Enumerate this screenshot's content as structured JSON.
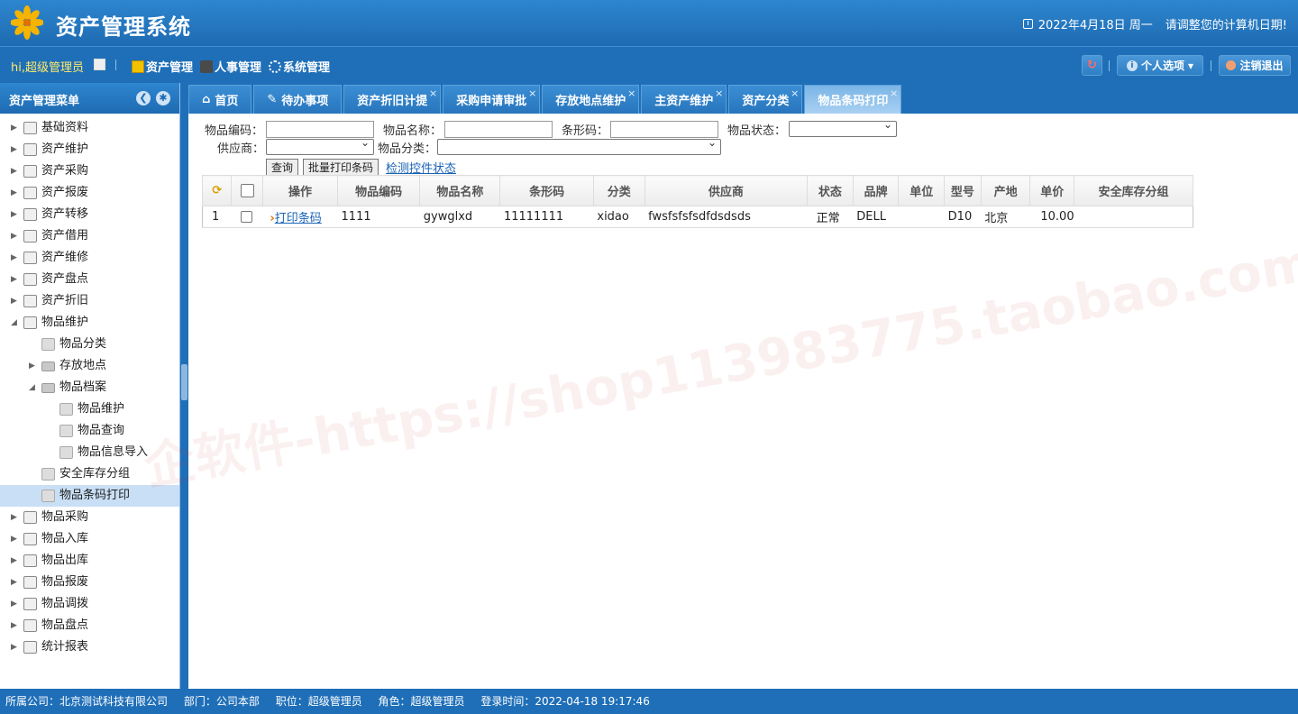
{
  "header": {
    "title": "资产管理系统",
    "date": "2022年4月18日 周一",
    "date_notice": "请调整您的计算机日期!"
  },
  "navbar": {
    "greeting": "hi,超级管理员",
    "menus": [
      "资产管理",
      "人事管理",
      "系统管理"
    ],
    "personal_options": "个人选项",
    "logout": "注销退出"
  },
  "sidebar": {
    "title": "资产管理菜单",
    "items": [
      {
        "label": "基础资料",
        "level": 0,
        "expanded": false
      },
      {
        "label": "资产维护",
        "level": 0,
        "expanded": false
      },
      {
        "label": "资产采购",
        "level": 0,
        "expanded": false
      },
      {
        "label": "资产报废",
        "level": 0,
        "expanded": false
      },
      {
        "label": "资产转移",
        "level": 0,
        "expanded": false
      },
      {
        "label": "资产借用",
        "level": 0,
        "expanded": false
      },
      {
        "label": "资产维修",
        "level": 0,
        "expanded": false
      },
      {
        "label": "资产盘点",
        "level": 0,
        "expanded": false
      },
      {
        "label": "资产折旧",
        "level": 0,
        "expanded": false
      },
      {
        "label": "物品维护",
        "level": 0,
        "expanded": true
      },
      {
        "label": "物品分类",
        "level": 1,
        "leaf": true
      },
      {
        "label": "存放地点",
        "level": 1,
        "expanded": false
      },
      {
        "label": "物品档案",
        "level": 1,
        "expanded": true
      },
      {
        "label": "物品维护",
        "level": 2,
        "leaf": true
      },
      {
        "label": "物品查询",
        "level": 2,
        "leaf": true
      },
      {
        "label": "物品信息导入",
        "level": 2,
        "leaf": true
      },
      {
        "label": "安全库存分组",
        "level": 1,
        "leaf": true
      },
      {
        "label": "物品条码打印",
        "level": 1,
        "leaf": true,
        "selected": true
      },
      {
        "label": "物品采购",
        "level": 0,
        "expanded": false
      },
      {
        "label": "物品入库",
        "level": 0,
        "expanded": false
      },
      {
        "label": "物品出库",
        "level": 0,
        "expanded": false
      },
      {
        "label": "物品报废",
        "level": 0,
        "expanded": false
      },
      {
        "label": "物品调拨",
        "level": 0,
        "expanded": false
      },
      {
        "label": "物品盘点",
        "level": 0,
        "expanded": false
      },
      {
        "label": "统计报表",
        "level": 0,
        "expanded": false
      }
    ]
  },
  "tabs": [
    {
      "label": "首页",
      "closable": false
    },
    {
      "label": "待办事项",
      "closable": false
    },
    {
      "label": "资产折旧计提",
      "closable": true
    },
    {
      "label": "采购申请审批",
      "closable": true
    },
    {
      "label": "存放地点维护",
      "closable": true
    },
    {
      "label": "主资产维护",
      "closable": true
    },
    {
      "label": "资产分类",
      "closable": true
    },
    {
      "label": "物品条码打印",
      "closable": true,
      "active": true
    }
  ],
  "form": {
    "code_label": "物品编码：",
    "name_label": "物品名称：",
    "barcode_label": "条形码：",
    "status_label": "物品状态：",
    "supplier_label": "供应商：",
    "category_label": "物品分类：",
    "query_btn": "查询",
    "batch_print_btn": "批量打印条码",
    "check_link": "检测控件状态"
  },
  "grid": {
    "columns": [
      "操作",
      "物品编码",
      "物品名称",
      "条形码",
      "分类",
      "供应商",
      "状态",
      "品牌",
      "单位",
      "型号",
      "产地",
      "单价",
      "安全库存分组"
    ],
    "rows": [
      {
        "num": "1",
        "action": "打印条码",
        "code": "1111",
        "name": "gywglxd",
        "barcode": "11111111",
        "category": "xidao",
        "supplier": "fwsfsfsfsdfdsdsds",
        "status": "正常",
        "brand": "DELL",
        "unit": "",
        "model": "D10",
        "origin": "北京",
        "price": "10.00",
        "group": ""
      }
    ]
  },
  "footer": {
    "company": "所属公司：北京测试科技有限公司",
    "dept": "部门：公司本部",
    "position": "职位：超级管理员",
    "role": "角色：超级管理员",
    "login_time": "登录时间：2022-04-18 19:17:46"
  },
  "watermark": "企软件-https://shop113983775.taobao.com",
  "colors": {
    "primary": "#1f6fb8",
    "link": "#1a63b6",
    "greeting": "#ffea6a"
  }
}
